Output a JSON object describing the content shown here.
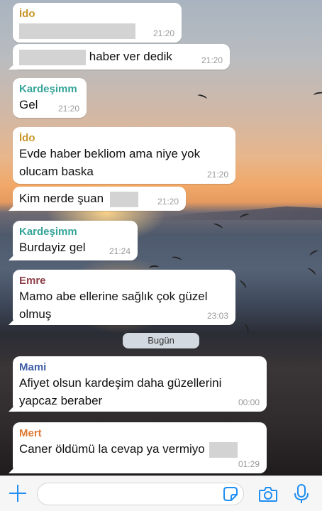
{
  "colors": {
    "sender_ido": "#c8962a",
    "sender_kardesimm": "#34a398",
    "sender_emre": "#8b3f47",
    "sender_mami": "#3f5fa8",
    "sender_mert": "#e07a32",
    "accent": "#1f8ef1"
  },
  "messages": [
    {
      "sender": "İdo",
      "text": "",
      "time": "21:20"
    },
    {
      "sender": "",
      "text": "haber ver dedik",
      "time": "21:20"
    },
    {
      "sender": "Kardeşimm",
      "text": "Gel",
      "time": "21:20"
    },
    {
      "sender": "İdo",
      "text_line1": "Evde haber bekliom ama niye yok",
      "text_line2": "olucam baska",
      "time": "21:20"
    },
    {
      "sender": "",
      "text": "Kim nerde şuan",
      "time": "21:20"
    },
    {
      "sender": "Kardeşimm",
      "text": "Burdayiz gel",
      "time": "21:24"
    },
    {
      "sender": "Emre",
      "text_line1": "Mamo abe ellerine sağlık çok güzel",
      "text_line2": "olmuş",
      "time": "23:03"
    },
    {
      "sender": "Mami",
      "text_line1": "Afiyet olsun kardeşim  daha güzellerini",
      "text_line2": "yapcaz beraber",
      "time": "00:00"
    },
    {
      "sender": "Mert",
      "text": "Caner öldümü la cevap ya vermiyo",
      "time": "01:29"
    }
  ],
  "date_divider": "Bugün",
  "input": {
    "value": "",
    "placeholder": ""
  },
  "icons": [
    "plus-icon",
    "sticker-icon",
    "camera-icon",
    "microphone-icon"
  ]
}
